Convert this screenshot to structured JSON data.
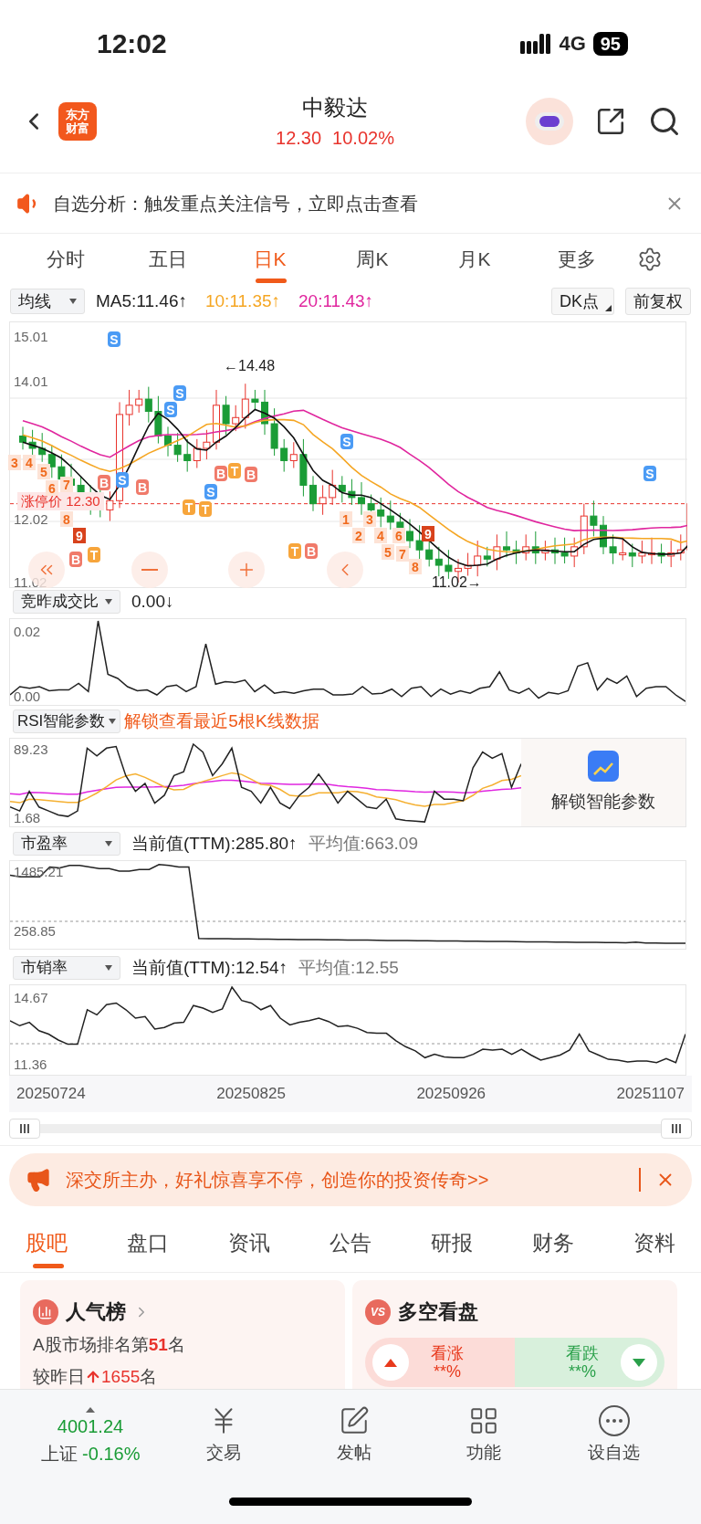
{
  "status_bar": {
    "time": "12:02",
    "network": "4G",
    "battery": "95"
  },
  "header": {
    "logo_lines": [
      "东方",
      "财富"
    ],
    "title": "中毅达",
    "price": "12.30",
    "change": "10.02%"
  },
  "notice": {
    "text": "自选分析：触发重点关注信号，立即点击查看"
  },
  "period_tabs": [
    {
      "label": "分时",
      "selected": false
    },
    {
      "label": "五日",
      "selected": false
    },
    {
      "label": "日K",
      "selected": true
    },
    {
      "label": "周K",
      "selected": false
    },
    {
      "label": "月K",
      "selected": false
    },
    {
      "label": "更多",
      "selected": false
    }
  ],
  "chart_toolbar": {
    "indicator": "均线",
    "ma": [
      {
        "text": "MA5:11.46↑",
        "color": "#222222"
      },
      {
        "text": "10:11.35↑",
        "color": "#f5a623"
      },
      {
        "text": "20:11.43↑",
        "color": "#e0269e"
      }
    ],
    "dk_button": "DK点",
    "adjust_button": "前复权"
  },
  "kline": {
    "y_labels": [
      "15.01",
      "14.01",
      "12.02",
      "11.02"
    ],
    "high_label": "←14.48",
    "low_label": "11.02→",
    "limit_label": "涨停价",
    "limit_value": "12.30",
    "markers": [
      {
        "text": "3",
        "kind": "n"
      },
      {
        "text": "4",
        "kind": "n"
      },
      {
        "text": "5",
        "kind": "n"
      },
      {
        "text": "6",
        "kind": "n"
      },
      {
        "text": "7",
        "kind": "n"
      },
      {
        "text": "8",
        "kind": "n"
      },
      {
        "text": "B",
        "kind": "b"
      },
      {
        "text": "9",
        "kind": "nine"
      },
      {
        "text": "T",
        "kind": "t"
      },
      {
        "text": "B",
        "kind": "b"
      },
      {
        "text": "S",
        "kind": "s"
      },
      {
        "text": "S",
        "kind": "s"
      },
      {
        "text": "B",
        "kind": "b"
      },
      {
        "text": "S",
        "kind": "s"
      },
      {
        "text": "S",
        "kind": "s"
      },
      {
        "text": "T",
        "kind": "t"
      },
      {
        "text": "T",
        "kind": "t"
      },
      {
        "text": "S",
        "kind": "s"
      },
      {
        "text": "B",
        "kind": "b"
      },
      {
        "text": "T",
        "kind": "t"
      },
      {
        "text": "B",
        "kind": "b"
      },
      {
        "text": "T",
        "kind": "t"
      },
      {
        "text": "B",
        "kind": "b"
      },
      {
        "text": "S",
        "kind": "s"
      },
      {
        "text": "1",
        "kind": "n"
      },
      {
        "text": "2",
        "kind": "n"
      },
      {
        "text": "3",
        "kind": "n"
      },
      {
        "text": "4",
        "kind": "n"
      },
      {
        "text": "5",
        "kind": "n"
      },
      {
        "text": "6",
        "kind": "n"
      },
      {
        "text": "7",
        "kind": "n"
      },
      {
        "text": "8",
        "kind": "n"
      },
      {
        "text": "9",
        "kind": "nine"
      },
      {
        "text": "S",
        "kind": "s"
      }
    ]
  },
  "volume_ratio": {
    "indicator": "竞昨成交比",
    "value": "0.00↓",
    "max": "0.02",
    "min": "0.00"
  },
  "rsi": {
    "indicator": "RSI智能参数",
    "promo": "解锁查看最近5根K线数据",
    "max": "89.23",
    "min": "1.68",
    "unlock": "解锁智能参数"
  },
  "pe": {
    "indicator": "市盈率",
    "current": "当前值(TTM):285.80↑",
    "average": "平均值:663.09",
    "max": "1485.21",
    "min": "258.85"
  },
  "ps": {
    "indicator": "市销率",
    "current": "当前值(TTM):12.54↑",
    "average": "平均值:12.55",
    "max": "14.67",
    "min": "11.36"
  },
  "dates": [
    "20250724",
    "20250825",
    "20250926",
    "20251107"
  ],
  "banner": {
    "text": "深交所主办，好礼惊喜享不停，创造你的投资传奇>>"
  },
  "info_tabs": [
    {
      "label": "股吧",
      "selected": true
    },
    {
      "label": "盘口",
      "selected": false
    },
    {
      "label": "资讯",
      "selected": false
    },
    {
      "label": "公告",
      "selected": false
    },
    {
      "label": "研报",
      "selected": false
    },
    {
      "label": "财务",
      "selected": false
    },
    {
      "label": "资料",
      "selected": false
    }
  ],
  "cards": {
    "popularity": {
      "title": "人气榜",
      "rank": "A股市场排名第**51**名",
      "change_prefix": "较昨日",
      "change_value": "1655",
      "change_suffix": "名"
    },
    "bull_bear": {
      "icon_text": "VS",
      "title": "多空看盘",
      "bull_label": "看涨",
      "bull_value": "**%",
      "bear_label": "看跌",
      "bear_value": "**%"
    }
  },
  "bottom_nav": {
    "index_value": "4001.24",
    "index_name": "上证",
    "index_change": "-0.16%",
    "items": [
      {
        "label": "交易",
        "kind": "trade"
      },
      {
        "label": "发帖",
        "kind": "post"
      },
      {
        "label": "功能",
        "kind": "apps"
      },
      {
        "label": "设自选",
        "kind": "more"
      }
    ]
  }
}
